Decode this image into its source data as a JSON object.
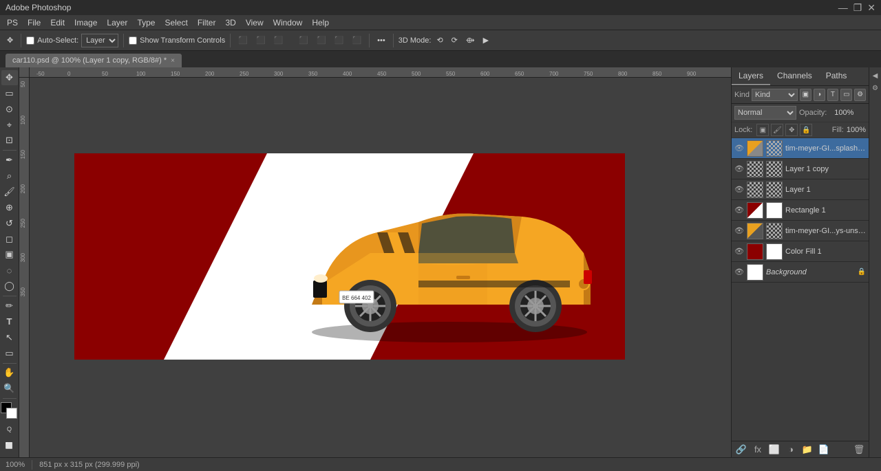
{
  "titlebar": {
    "title": "Adobe Photoshop",
    "minimize": "—",
    "maximize": "❐",
    "close": "✕"
  },
  "menubar": {
    "items": [
      "PS",
      "File",
      "Edit",
      "Image",
      "Layer",
      "Type",
      "Select",
      "Filter",
      "3D",
      "View",
      "Window",
      "Help"
    ]
  },
  "toolbar": {
    "auto_select_label": "Auto-Select:",
    "layer_select": "Layer",
    "show_transform": "Show Transform Controls",
    "align_items": [
      "align-left",
      "align-center",
      "align-right",
      "align-top",
      "align-middle",
      "align-bottom",
      "distribute-h"
    ],
    "more_btn": "•••",
    "three_d_btn": "3D Mode:"
  },
  "tab": {
    "name": "car110.psd @ 100% (Layer 1 copy, RGB/8#) *",
    "close": "×"
  },
  "tools": {
    "items": [
      {
        "name": "move-tool",
        "icon": "✥"
      },
      {
        "name": "selection-tool",
        "icon": "⬜"
      },
      {
        "name": "lasso-tool",
        "icon": "⊙"
      },
      {
        "name": "quick-select-tool",
        "icon": "⚲"
      },
      {
        "name": "crop-tool",
        "icon": "⊡"
      },
      {
        "name": "eyedropper-tool",
        "icon": "✒"
      },
      {
        "name": "healing-tool",
        "icon": "⌕"
      },
      {
        "name": "brush-tool",
        "icon": "🖌"
      },
      {
        "name": "clone-tool",
        "icon": "⊕"
      },
      {
        "name": "eraser-tool",
        "icon": "◻"
      },
      {
        "name": "gradient-tool",
        "icon": "▣"
      },
      {
        "name": "blur-tool",
        "icon": "◌"
      },
      {
        "name": "dodge-tool",
        "icon": "◯"
      },
      {
        "name": "pen-tool",
        "icon": "✏"
      },
      {
        "name": "text-tool",
        "icon": "T"
      },
      {
        "name": "path-selection-tool",
        "icon": "↖"
      },
      {
        "name": "shape-tool",
        "icon": "▭"
      },
      {
        "name": "hand-tool",
        "icon": "✋"
      },
      {
        "name": "zoom-tool",
        "icon": "🔍"
      }
    ]
  },
  "layers_panel": {
    "tabs": [
      "Layers",
      "Channels",
      "Paths"
    ],
    "active_tab": "Layers",
    "kind_label": "Kind",
    "blend_mode": "Normal",
    "opacity_label": "Opacity:",
    "opacity_value": "100%",
    "lock_label": "Lock:",
    "fill_label": "Fill:",
    "fill_value": "100%",
    "layers": [
      {
        "name": "tim-meyer-GI...splash copy",
        "visible": true,
        "selected": true,
        "type": "car-thumb",
        "locked": false
      },
      {
        "name": "Layer 1 copy",
        "visible": true,
        "selected": false,
        "type": "checker",
        "locked": false
      },
      {
        "name": "Layer 1",
        "visible": true,
        "selected": false,
        "type": "checker",
        "locked": false
      },
      {
        "name": "Rectangle 1",
        "visible": true,
        "selected": false,
        "type": "rect-thumb",
        "locked": false
      },
      {
        "name": "tim-meyer-GI...ys-unsplash",
        "visible": true,
        "selected": false,
        "type": "car-thumb2",
        "locked": false
      },
      {
        "name": "Color Fill 1",
        "visible": true,
        "selected": false,
        "type": "fill-thumb",
        "locked": false
      },
      {
        "name": "Background",
        "visible": true,
        "selected": false,
        "type": "bg-thumb",
        "locked": true,
        "italic": true
      }
    ],
    "bottom_buttons": [
      "link-icon",
      "fx-icon",
      "mask-icon",
      "adjustment-icon",
      "folder-icon",
      "new-layer-icon",
      "trash-icon"
    ]
  },
  "statusbar": {
    "zoom": "100%",
    "dimensions": "851 px x 315 px (299.999 ppi)"
  },
  "canvas": {
    "bg_color": "#8b0000",
    "stripe_color": "#ffffff"
  }
}
